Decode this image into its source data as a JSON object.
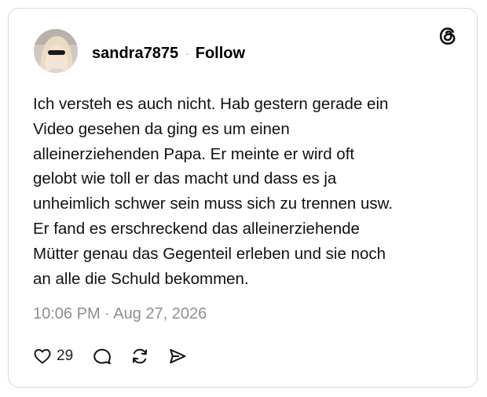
{
  "post": {
    "username": "sandra7875",
    "separator": "·",
    "follow_label": "Follow",
    "text": "Ich versteh es auch nicht. Hab gestern gerade ein\nVideo gesehen da ging es um einen\nalleinerziehenden Papa. Er meinte er wird oft\ngelobt wie toll er das macht und dass es ja\nunheimlich schwer sein muss sich zu trennen usw.\nEr fand es erschreckend das alleinerziehende\nMütter genau das Gegenteil erleben und sie noch\nan alle die Schuld bekommen.",
    "timestamp": "10:06 PM · Aug 27, 2026",
    "like_count": "29"
  },
  "icons": {
    "brand": "threads-logo-icon",
    "like": "heart-icon",
    "reply": "comment-bubble-icon",
    "repost": "repost-icon",
    "share": "send-icon"
  },
  "colors": {
    "text": "#111111",
    "muted": "#8f8f8f",
    "border": "#d9d9d9",
    "background": "#ffffff"
  }
}
